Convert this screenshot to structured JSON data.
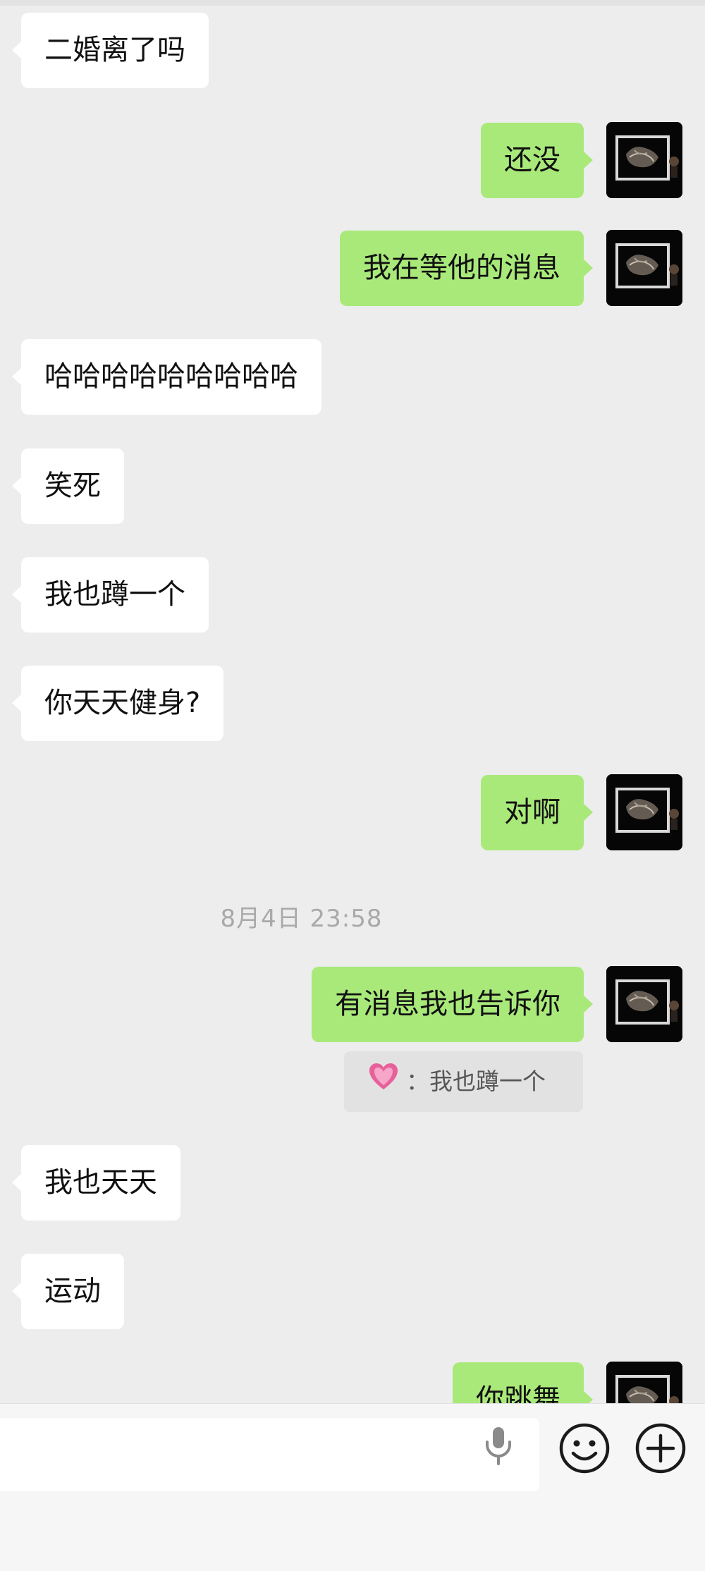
{
  "messages": [
    {
      "side": "in",
      "text": "二婚离了吗"
    },
    {
      "side": "out",
      "text": "还没"
    },
    {
      "side": "out",
      "text": "我在等他的消息"
    },
    {
      "side": "in",
      "text": "哈哈哈哈哈哈哈哈哈"
    },
    {
      "side": "in",
      "text": "笑死"
    },
    {
      "side": "in",
      "text": "我也蹲一个"
    },
    {
      "side": "in",
      "text": "你天天健身?"
    },
    {
      "side": "out",
      "text": "对啊"
    },
    {
      "side": "out",
      "text": "有消息我也告诉你"
    },
    {
      "side": "in",
      "text": "我也天天"
    },
    {
      "side": "in",
      "text": "运动"
    },
    {
      "side": "out",
      "text": "你跳舞"
    }
  ],
  "timestamp": "8月4日 23:58",
  "quote": {
    "text": "我也蹲一个",
    "separator": "：",
    "icon": "pink-heart-emoji"
  },
  "input_bar": {
    "voice_icon": "microphone-icon",
    "emoji_icon": "smiley-icon",
    "more_icon": "plus-circle-icon"
  },
  "colors": {
    "incoming": "#ffffff",
    "outgoing": "#a9e97a",
    "background": "#ededed"
  }
}
